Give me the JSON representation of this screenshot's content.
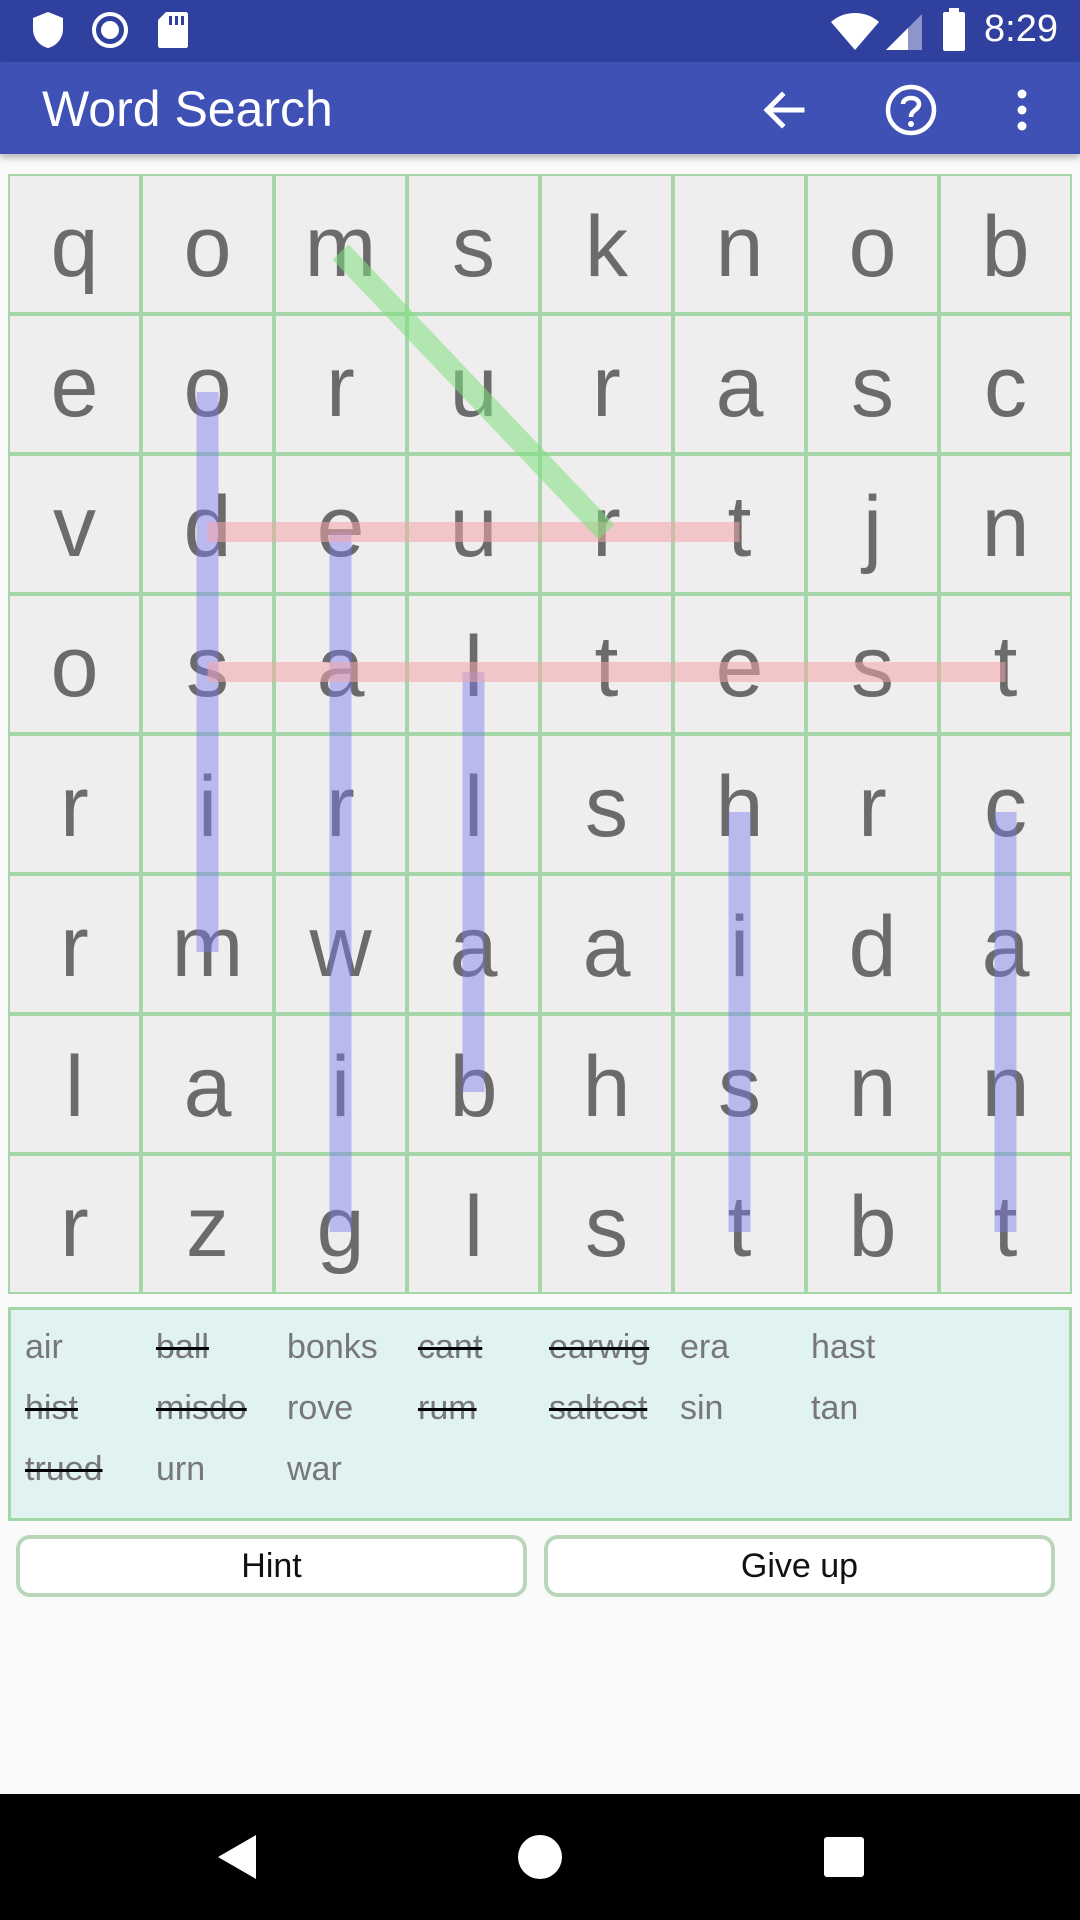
{
  "status_bar": {
    "time": "8:29",
    "left_icons": [
      "shield-icon",
      "record-icon",
      "sd-card-icon"
    ],
    "right_icons": [
      "wifi-icon",
      "cell-signal-icon",
      "battery-icon"
    ]
  },
  "app_bar": {
    "title": "Word Search",
    "actions": [
      "back-arrow-icon",
      "help-icon",
      "more-vert-icon"
    ]
  },
  "grid": {
    "rows": [
      [
        "q",
        "o",
        "m",
        "s",
        "k",
        "n",
        "o",
        "b"
      ],
      [
        "e",
        "o",
        "r",
        "u",
        "r",
        "a",
        "s",
        "c"
      ],
      [
        "v",
        "d",
        "e",
        "u",
        "r",
        "t",
        "j",
        "n"
      ],
      [
        "o",
        "s",
        "a",
        "l",
        "t",
        "e",
        "s",
        "t"
      ],
      [
        "r",
        "i",
        "r",
        "l",
        "s",
        "h",
        "r",
        "c"
      ],
      [
        "r",
        "m",
        "w",
        "a",
        "a",
        "i",
        "d",
        "a"
      ],
      [
        "l",
        "a",
        "i",
        "b",
        "h",
        "s",
        "n",
        "n"
      ],
      [
        "r",
        "z",
        "g",
        "l",
        "s",
        "t",
        "b",
        "t"
      ]
    ],
    "colors": {
      "cell_bg": "#efeded",
      "cell_border": "#a5d6a7",
      "found_vertical": "#7b7bf0",
      "found_horizontal": "#f4a6aa",
      "selection_diagonal": "#7ee07e"
    },
    "highlights": [
      {
        "word": "misdo",
        "from": [
          5,
          1
        ],
        "to": [
          1,
          1
        ],
        "color": "found_vertical"
      },
      {
        "word": "earwig",
        "from": [
          2,
          2
        ],
        "to": [
          7,
          2
        ],
        "color": "found_vertical"
      },
      {
        "word": "ball",
        "from": [
          6,
          3
        ],
        "to": [
          3,
          3
        ],
        "color": "found_vertical"
      },
      {
        "word": "hist",
        "from": [
          4,
          5
        ],
        "to": [
          7,
          5
        ],
        "color": "found_vertical"
      },
      {
        "word": "cant",
        "from": [
          4,
          7
        ],
        "to": [
          7,
          7
        ],
        "color": "found_vertical"
      },
      {
        "word": "trued",
        "from": [
          2,
          5
        ],
        "to": [
          2,
          1
        ],
        "color": "found_horizontal"
      },
      {
        "word": "saltest",
        "from": [
          3,
          1
        ],
        "to": [
          3,
          7
        ],
        "color": "found_horizontal"
      },
      {
        "word": "rum",
        "from": [
          2,
          4
        ],
        "to": [
          0,
          2
        ],
        "color": "selection_diagonal"
      }
    ]
  },
  "word_list": {
    "words": [
      {
        "text": "air",
        "found": false
      },
      {
        "text": "ball",
        "found": true
      },
      {
        "text": "bonks",
        "found": false
      },
      {
        "text": "cant",
        "found": true
      },
      {
        "text": "earwig",
        "found": true
      },
      {
        "text": "era",
        "found": false
      },
      {
        "text": "hast",
        "found": false
      },
      {
        "text": "hist",
        "found": true
      },
      {
        "text": "misdo",
        "found": true
      },
      {
        "text": "rove",
        "found": false
      },
      {
        "text": "rum",
        "found": true
      },
      {
        "text": "saltest",
        "found": true
      },
      {
        "text": "sin",
        "found": false
      },
      {
        "text": "tan",
        "found": false
      },
      {
        "text": "trued",
        "found": true
      },
      {
        "text": "urn",
        "found": false
      },
      {
        "text": "war",
        "found": false
      }
    ]
  },
  "buttons": {
    "hint": "Hint",
    "give_up": "Give up"
  },
  "nav_bar": {
    "icons": [
      "nav-back-icon",
      "nav-home-icon",
      "nav-recents-icon"
    ]
  }
}
